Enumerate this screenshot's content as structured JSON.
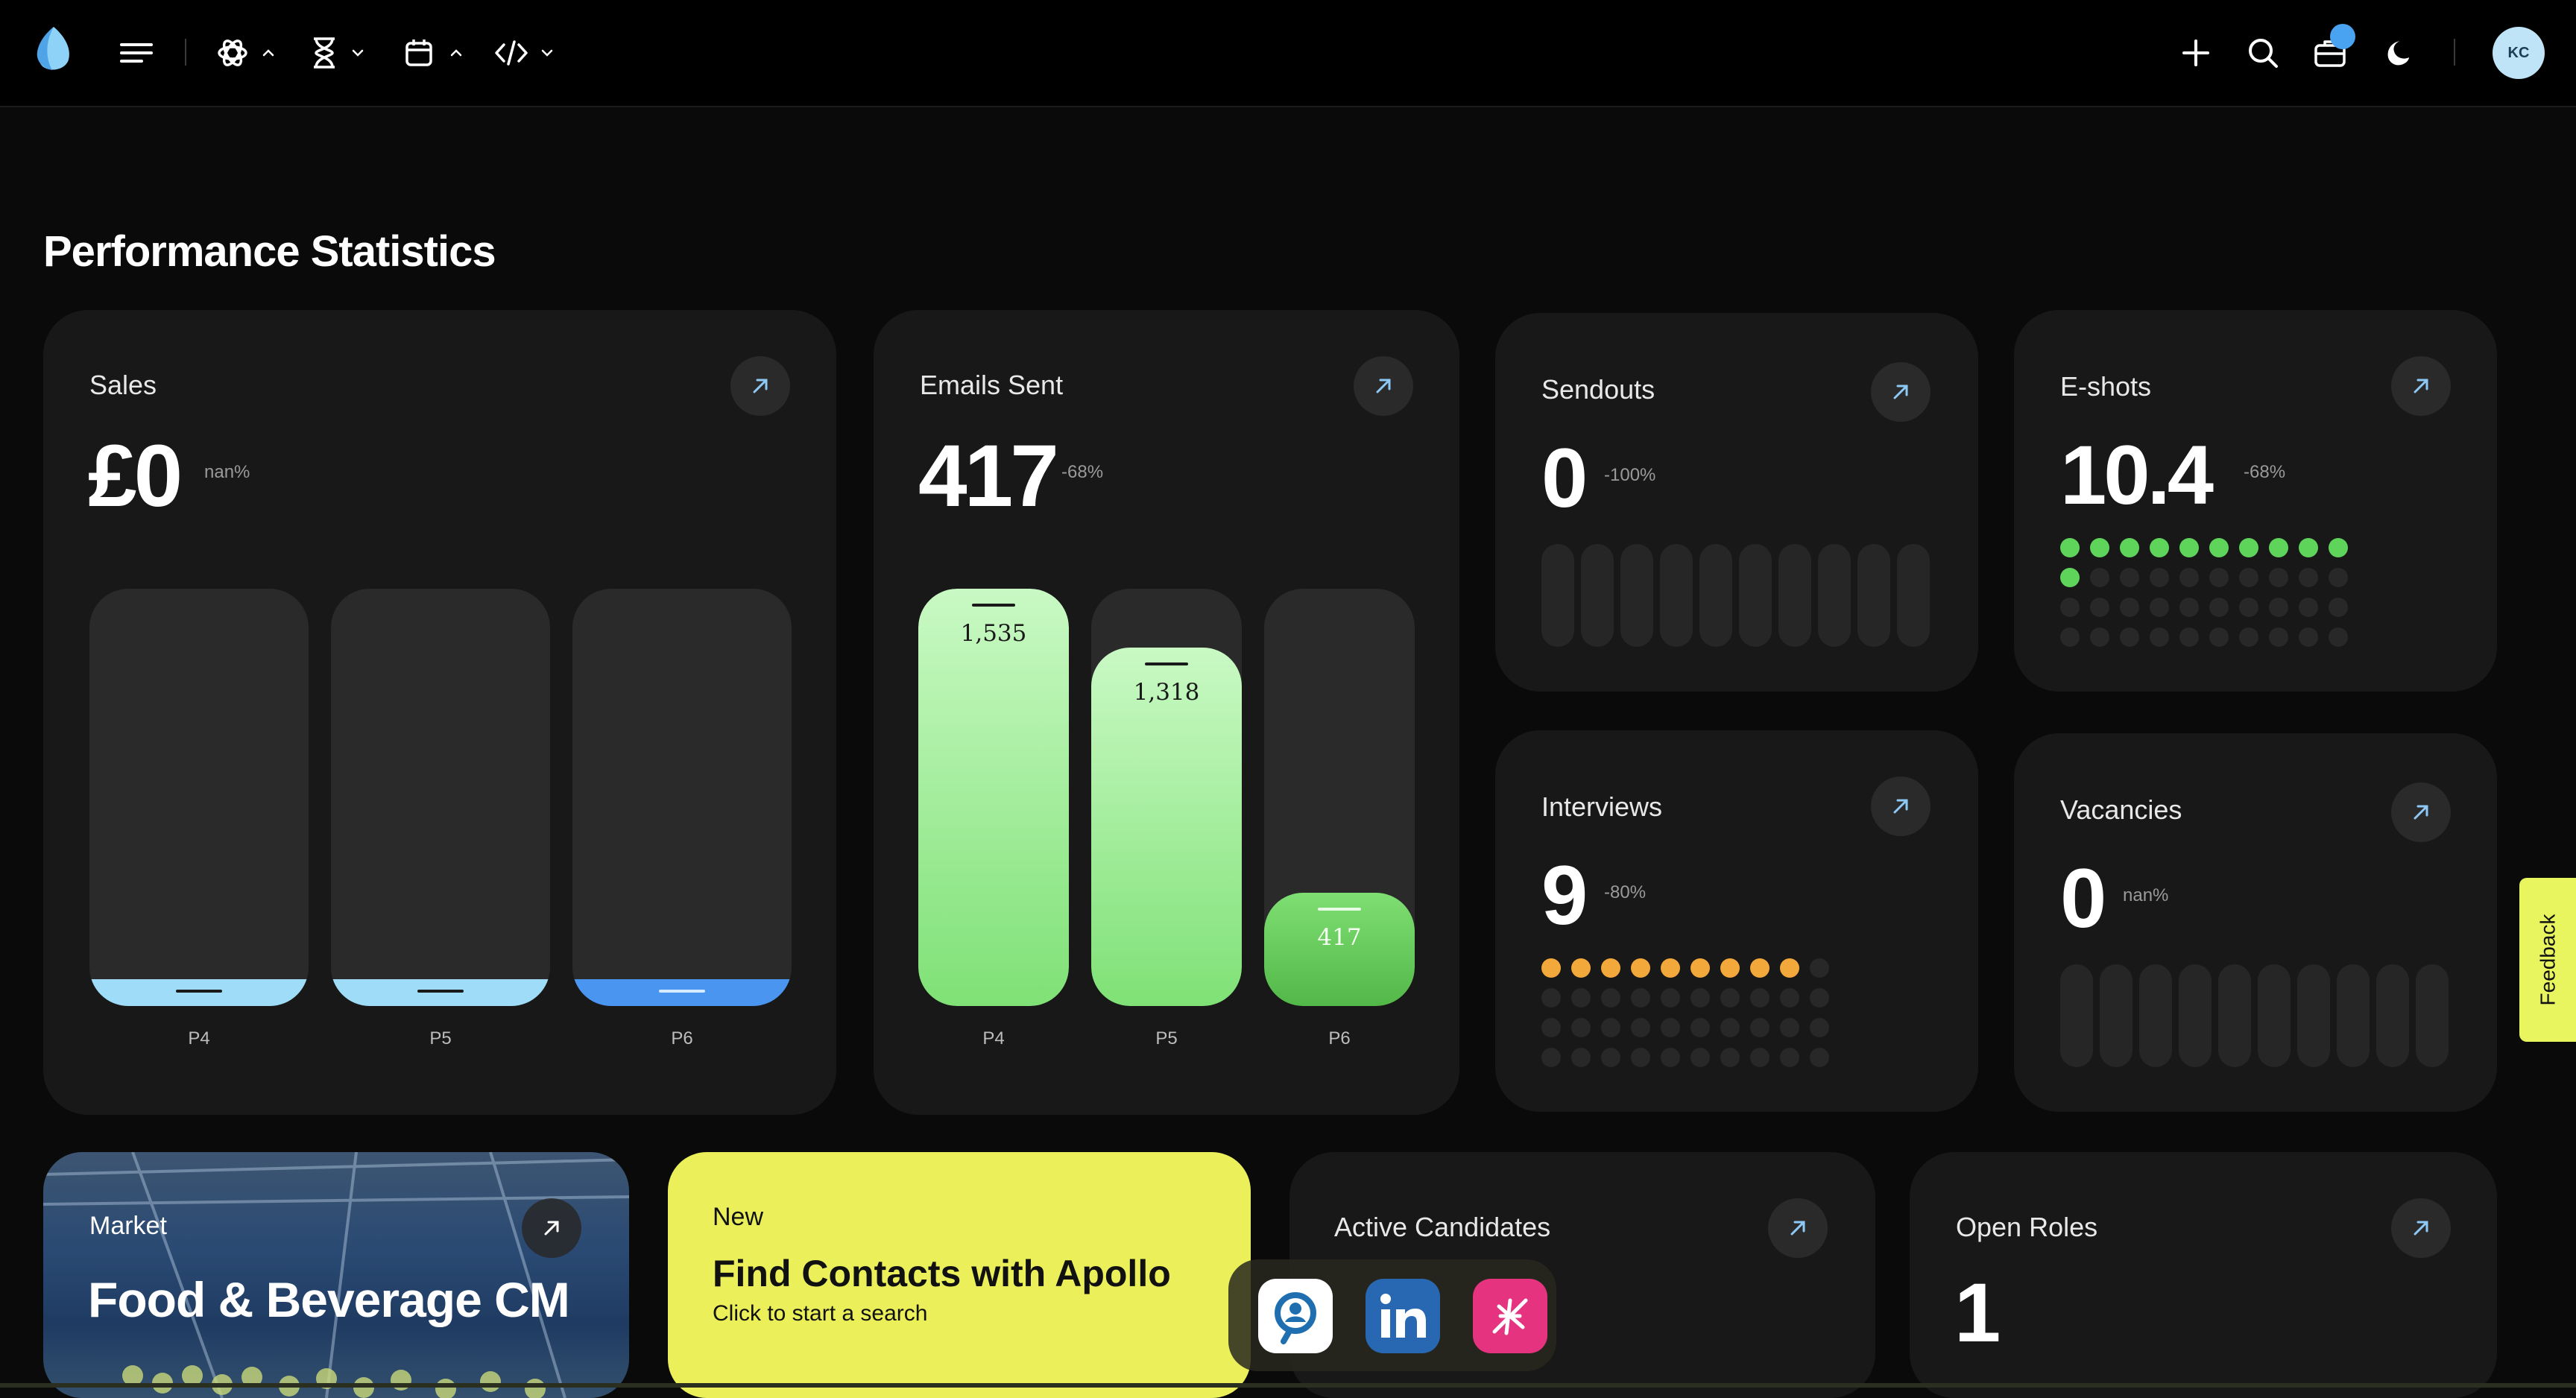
{
  "header": {
    "icons": [
      "logo-icon",
      "menu-icon",
      "ai-model-icon",
      "chevron-up-icon",
      "hourglass-icon",
      "chevron-down-icon",
      "calendar-icon",
      "chevron-up-icon",
      "code-icon",
      "chevron-down-icon",
      "plus-icon",
      "search-icon",
      "briefcase-icon",
      "moon-icon"
    ],
    "avatar_initials": "KC"
  },
  "page_title": "Performance Statistics",
  "cards": {
    "sales": {
      "label": "Sales",
      "value": "£0",
      "delta": "nan%",
      "chart_data": {
        "type": "bar",
        "categories": [
          "P4",
          "P5",
          "P6"
        ],
        "values": [
          0,
          0,
          0
        ]
      }
    },
    "emails": {
      "label": "Emails Sent",
      "value": "417",
      "delta": "-68%",
      "chart_data": {
        "type": "bar",
        "categories": [
          "P4",
          "P5",
          "P6"
        ],
        "values": [
          1535,
          1318,
          417
        ],
        "value_labels": [
          "1,535",
          "1,318",
          "417"
        ]
      }
    },
    "sendouts": {
      "label": "Sendouts",
      "value": "0",
      "delta": "-100%",
      "filled": 0,
      "total": 10
    },
    "eshots": {
      "label": "E-shots",
      "value": "10.4",
      "delta": "-68%",
      "filled": 11,
      "total": 40,
      "color": "#5ed45b"
    },
    "interviews": {
      "label": "Interviews",
      "value": "9",
      "delta": "-80%",
      "filled": 9,
      "total": 40,
      "color": "#f2a83a"
    },
    "vacancies": {
      "label": "Vacancies",
      "value": "0",
      "delta": "nan%",
      "filled": 0,
      "total": 10
    }
  },
  "bottom": {
    "market": {
      "label": "Market",
      "title": "Food & Beverage CM"
    },
    "apollo": {
      "tag": "New",
      "title": "Find Contacts with Apollo",
      "subtitle": "Click to start a search"
    },
    "active_candidates": {
      "label": "Active Candidates"
    },
    "open_roles": {
      "label": "Open Roles",
      "value": "1"
    }
  },
  "feedback": "Feedback",
  "dock": [
    "search-person-icon",
    "linkedin-icon",
    "spark-icon"
  ]
}
